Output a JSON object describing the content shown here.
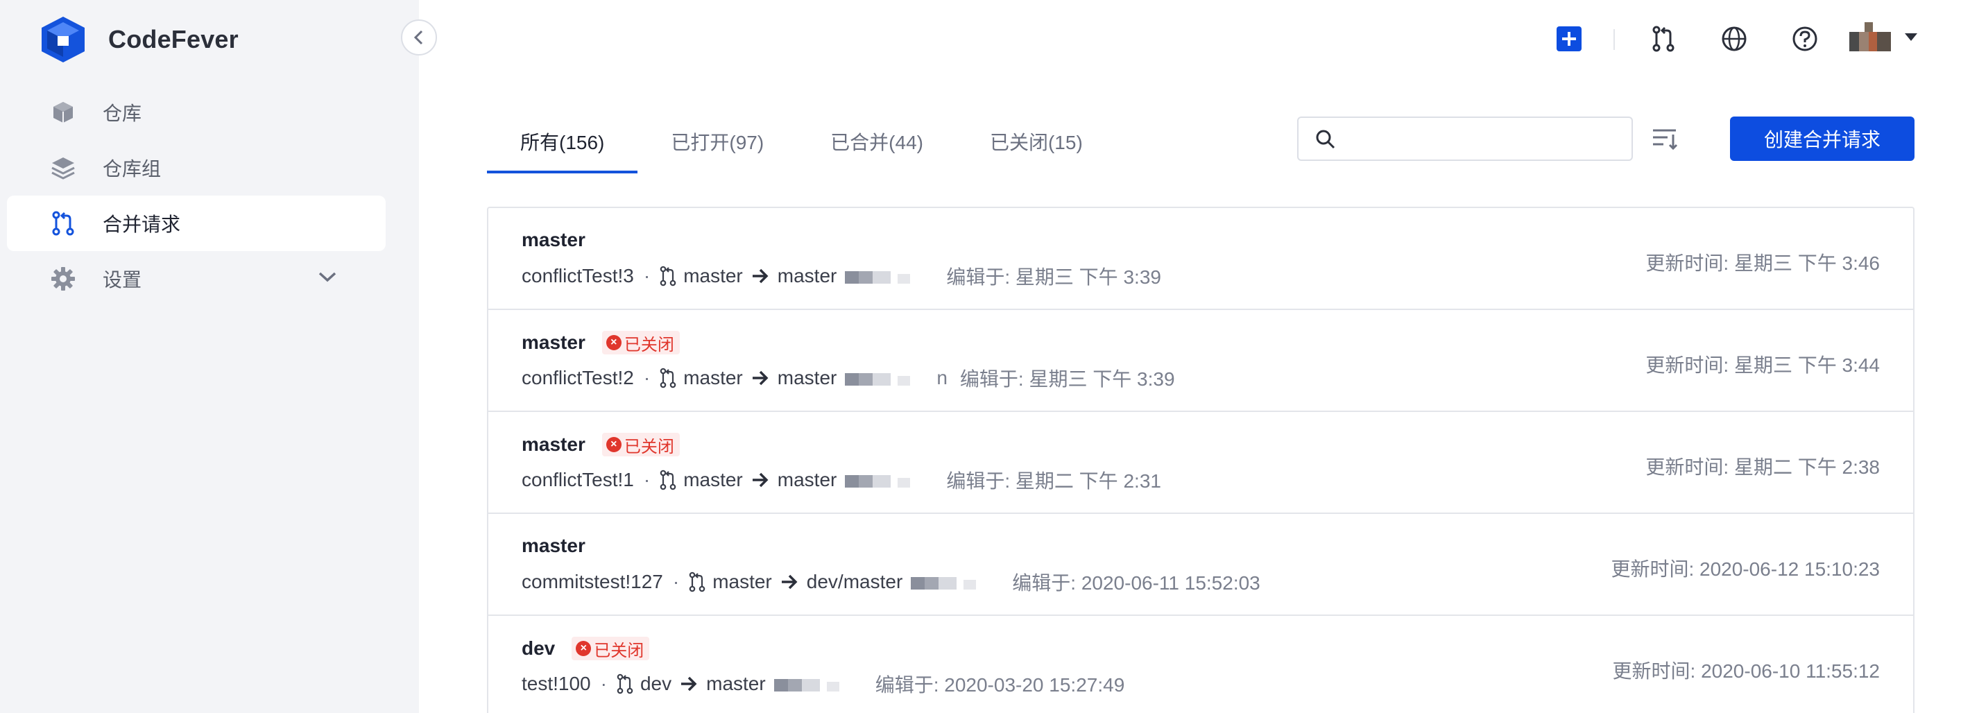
{
  "app": {
    "name": "CodeFever"
  },
  "sidebar": {
    "items": [
      {
        "label": "仓库",
        "icon": "cube-icon"
      },
      {
        "label": "仓库组",
        "icon": "layers-icon"
      },
      {
        "label": "合并请求",
        "icon": "merge-request-icon",
        "active": true
      },
      {
        "label": "设置",
        "icon": "gear-icon"
      }
    ]
  },
  "tabs": [
    {
      "label": "所有(156)",
      "active": true
    },
    {
      "label": "已打开(97)"
    },
    {
      "label": "已合并(44)"
    },
    {
      "label": "已关闭(15)"
    }
  ],
  "search": {
    "value": "",
    "placeholder": ""
  },
  "create_button": "创建合并请求",
  "badge_closed": "已关闭",
  "labels": {
    "edited": "编辑于:",
    "updated": "更新时间:"
  },
  "requests": [
    {
      "title": "master",
      "closed": false,
      "id": "conflictTest!3",
      "source": "master",
      "target": "master",
      "edited": "星期三 下午 3:39",
      "updated": "星期三 下午 3:46"
    },
    {
      "title": "master",
      "closed": true,
      "id": "conflictTest!2",
      "source": "master",
      "target": "master",
      "author_suffix": "n",
      "edited": "星期三 下午 3:39",
      "updated": "星期三 下午 3:44"
    },
    {
      "title": "master",
      "closed": true,
      "id": "conflictTest!1",
      "source": "master",
      "target": "master",
      "edited": "星期二 下午 2:31",
      "updated": "星期二 下午 2:38"
    },
    {
      "title": "master",
      "closed": false,
      "id": "commitstest!127",
      "source": "master",
      "target": "dev/master",
      "edited": "2020-06-11 15:52:03",
      "updated": "2020-06-12 15:10:23"
    },
    {
      "title": "dev",
      "closed": true,
      "id": "test!100",
      "source": "dev",
      "target": "master",
      "edited": "2020-03-20 15:27:49",
      "updated": "2020-06-10 11:55:12"
    }
  ]
}
